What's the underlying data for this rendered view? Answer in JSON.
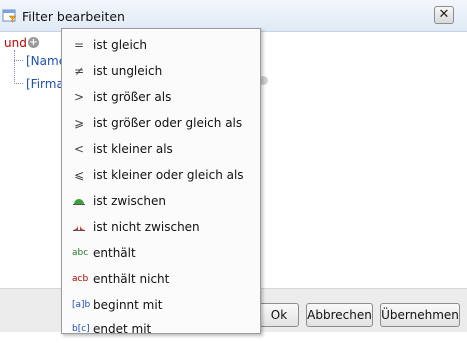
{
  "window": {
    "title": "Filter bearbeiten",
    "close_glyph": "✕"
  },
  "tree": {
    "root": "und",
    "items": [
      "[Name]",
      "[Firma]"
    ]
  },
  "menu": {
    "items": [
      {
        "icon": "=",
        "label": "ist gleich"
      },
      {
        "icon": "≠",
        "label": "ist ungleich"
      },
      {
        "icon": ">",
        "label": "ist größer als"
      },
      {
        "icon": "⩾",
        "label": "ist größer oder gleich als"
      },
      {
        "icon": "<",
        "label": "ist kleiner als"
      },
      {
        "icon": "⩽",
        "label": "ist kleiner oder gleich als"
      },
      {
        "icon": "between",
        "label": "ist zwischen"
      },
      {
        "icon": "not-between",
        "label": "ist nicht zwischen"
      },
      {
        "icon": "abc",
        "label": "enthält"
      },
      {
        "icon": "acb",
        "label": "enthält nicht"
      },
      {
        "icon": "[a]b",
        "label": "beginnt mit"
      },
      {
        "icon": "b[c]",
        "label": "endet mit"
      }
    ]
  },
  "buttons": {
    "ok": "Ok",
    "cancel": "Abbrechen",
    "apply": "Übernehmen"
  }
}
